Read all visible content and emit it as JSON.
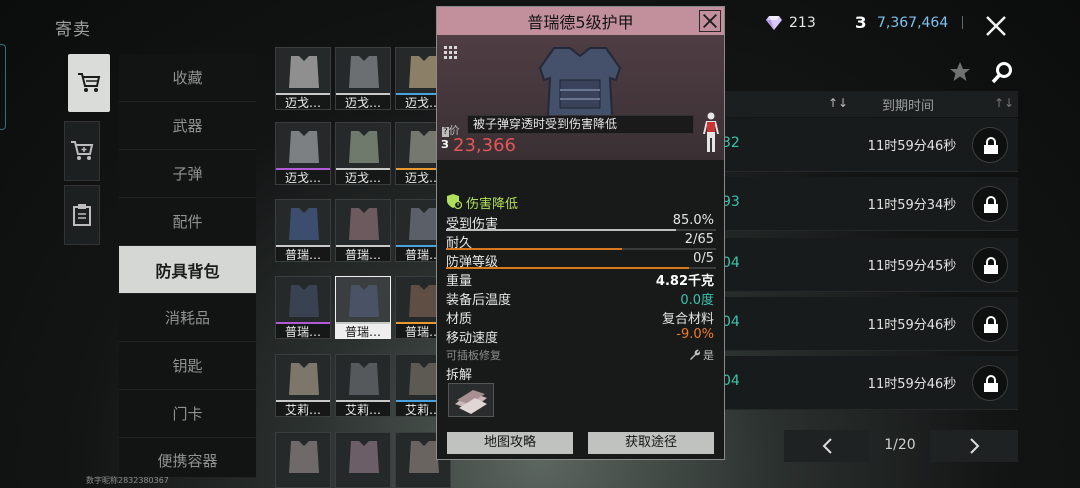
{
  "header": {
    "title": "寄卖",
    "diamond_count": "213",
    "coin_symbol": "З",
    "coin_count": "7,367,464"
  },
  "side_tabs": {
    "icons": [
      "cart-icon",
      "sell-cart-icon",
      "clipboard-icon"
    ]
  },
  "categories": [
    {
      "label": "收藏"
    },
    {
      "label": "武器"
    },
    {
      "label": "子弹"
    },
    {
      "label": "配件"
    },
    {
      "label": "防具背包"
    },
    {
      "label": "消耗品"
    },
    {
      "label": "钥匙"
    },
    {
      "label": "门卡"
    },
    {
      "label": "便携容器"
    }
  ],
  "grid": [
    [
      {
        "name": "迈戈…",
        "bar": "#c9c9c9"
      },
      {
        "name": "迈戈…",
        "bar": "#c9c9c9"
      },
      {
        "name": "迈戈…",
        "bar": "#4aa3e0"
      }
    ],
    [
      {
        "name": "迈戈…",
        "bar": "#b25ad6"
      },
      {
        "name": "迈戈…",
        "bar": "#c9c9c9"
      },
      {
        "name": "迈戈…",
        "bar": "#e89a2e"
      }
    ],
    [
      {
        "name": "普瑞…",
        "bar": "#c9c9c9"
      },
      {
        "name": "普瑞…",
        "bar": "#c9c9c9"
      },
      {
        "name": "普瑞…",
        "bar": "#4aa3e0"
      }
    ],
    [
      {
        "name": "普瑞…",
        "bar": "#b25ad6"
      },
      {
        "name": "普瑞…",
        "bar": "#c9c9c9"
      },
      {
        "name": "普瑞…",
        "bar": "#e89a2e"
      }
    ],
    [
      {
        "name": "艾莉…",
        "bar": "#c9c9c9"
      },
      {
        "name": "艾莉…",
        "bar": "#c9c9c9"
      },
      {
        "name": "艾莉…",
        "bar": "#4aa3e0"
      }
    ],
    [
      {
        "name": "",
        "bar": "#c9c9c9"
      },
      {
        "name": "",
        "bar": "#c9c9c9"
      },
      {
        "name": "",
        "bar": "#c9c9c9"
      }
    ]
  ],
  "list": {
    "expire_header": "到期时间",
    "sort_icon": "↑↓",
    "rows": [
      {
        "num": "32",
        "time": "11时59分46秒"
      },
      {
        "num": "93",
        "time": "11时59分34秒"
      },
      {
        "num": "04",
        "time": "11时59分45秒"
      },
      {
        "num": "04",
        "time": "11时59分46秒"
      },
      {
        "num": "04",
        "time": "11时59分46秒"
      }
    ],
    "page": "1/20"
  },
  "popup": {
    "title": "普瑞德5级护甲",
    "tooltip": "被子弹穿透时受到伤害降低",
    "price_label": "价",
    "price_coin": "З",
    "price_value": "23,366",
    "effect_label": "伤害降低",
    "stats": [
      {
        "key": "受到伤害",
        "value": "85.0%",
        "bar": 0.85,
        "bar_color": "#bdbdbd"
      },
      {
        "key": "耐久",
        "value": "2/65",
        "bar": 0.65,
        "bar_color": "#d8791e"
      },
      {
        "key": "防弹等级",
        "value": "0/5",
        "bar": 0.9,
        "bar_color": "#d8791e"
      },
      {
        "key": "重量",
        "value": "4.82千克"
      },
      {
        "key": "装备后温度",
        "value": "0.0度",
        "value_color": "#3cc3ad"
      },
      {
        "key": "材质",
        "value": "复合材料"
      },
      {
        "key": "移动速度",
        "value": "-9.0%",
        "value_color": "#f07a2a"
      },
      {
        "key": "可插板修复",
        "value": "是",
        "key_color": "#8a8e8c",
        "value_color": "#bdbdbd",
        "small": true
      }
    ],
    "disassemble_label": "拆解",
    "map_button": "地图攻略",
    "source_button": "获取途径"
  },
  "footer": {
    "id_text": "数字昵称2832380367"
  }
}
